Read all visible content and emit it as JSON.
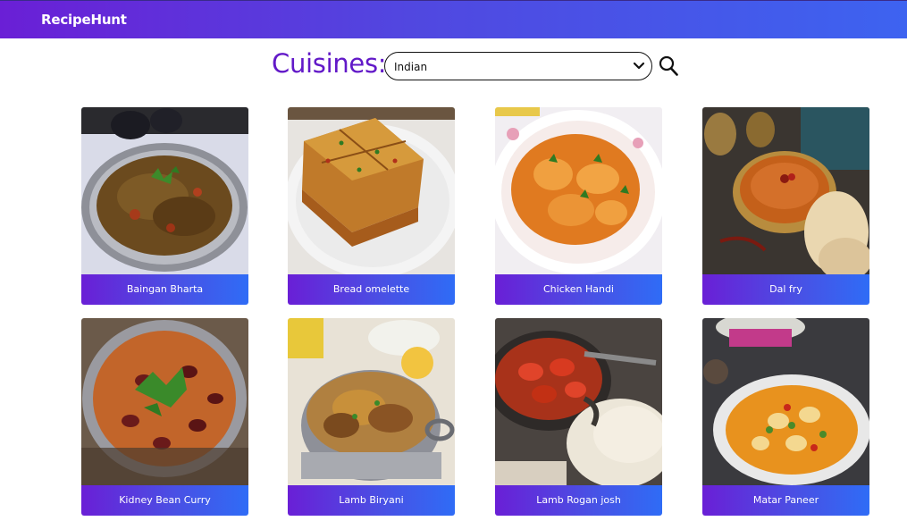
{
  "navbar": {
    "brand": "RecipeHunt"
  },
  "search": {
    "label": "Cuisines:",
    "selected_cuisine": "Indian",
    "icons": {
      "dropdown": "chevron-down-icon",
      "search": "search-icon"
    }
  },
  "recipes": [
    {
      "name": "Baingan Bharta"
    },
    {
      "name": "Bread omelette"
    },
    {
      "name": "Chicken Handi"
    },
    {
      "name": "Dal fry"
    },
    {
      "name": "Kidney Bean Curry"
    },
    {
      "name": "Lamb Biryani"
    },
    {
      "name": "Lamb Rogan josh"
    },
    {
      "name": "Matar Paneer"
    }
  ],
  "colors": {
    "brand_gradient_start": "#6a1fd6",
    "brand_gradient_end": "#3d63f0",
    "label_color": "#6219c8"
  }
}
